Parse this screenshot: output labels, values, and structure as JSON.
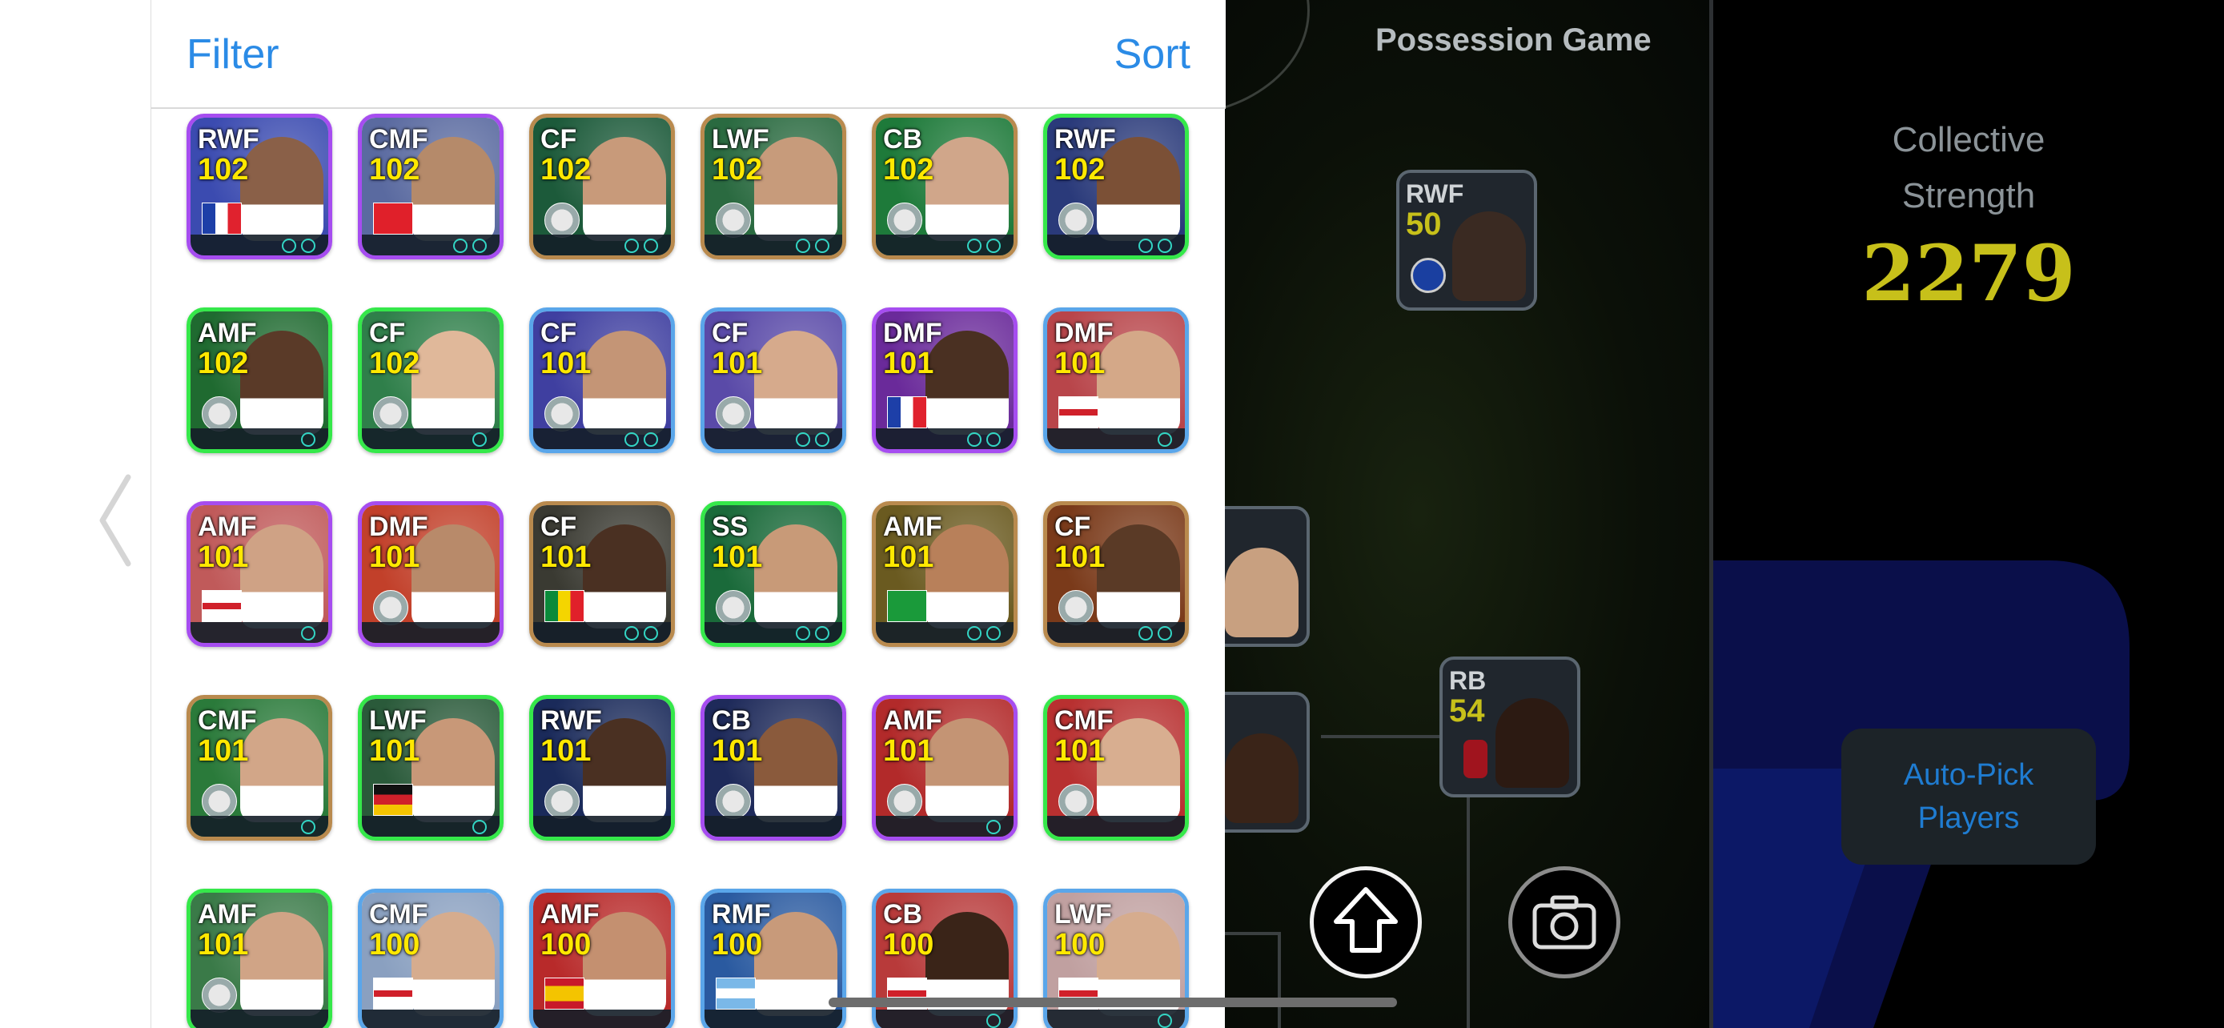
{
  "panel": {
    "filter_label": "Filter",
    "sort_label": "Sort"
  },
  "players": [
    {
      "pos": "RWF",
      "rating": "102",
      "flag": "france",
      "border": "purple",
      "chips": 2,
      "bg": "#3b4bb0",
      "photo": "#8a6048"
    },
    {
      "pos": "CMF",
      "rating": "102",
      "flag": "turkey",
      "border": "purple",
      "chips": 2,
      "bg": "#5a6aa0",
      "photo": "#b58a6a"
    },
    {
      "pos": "CF",
      "rating": "102",
      "flag": "club-crest",
      "border": "gold",
      "chips": 2,
      "bg": "#1c5a3a",
      "photo": "#c89a7a"
    },
    {
      "pos": "LWF",
      "rating": "102",
      "flag": "club-crest",
      "border": "gold",
      "chips": 2,
      "bg": "#2a6a40",
      "photo": "#c79b7b"
    },
    {
      "pos": "CB",
      "rating": "102",
      "flag": "club-crest",
      "border": "gold",
      "chips": 2,
      "bg": "#1e7a3a",
      "photo": "#d0a68a"
    },
    {
      "pos": "RWF",
      "rating": "102",
      "flag": "club-crest",
      "border": "green",
      "chips": 2,
      "bg": "#2a3a7a",
      "photo": "#7b5036"
    },
    {
      "pos": "AMF",
      "rating": "102",
      "flag": "club-crest",
      "border": "green",
      "chips": 1,
      "bg": "#1f6a30",
      "photo": "#5a3a28"
    },
    {
      "pos": "CF",
      "rating": "102",
      "flag": "club-crest",
      "border": "green",
      "chips": 1,
      "bg": "#2f7f4a",
      "photo": "#e0b89a"
    },
    {
      "pos": "CF",
      "rating": "101",
      "flag": "club-crest",
      "border": "blue",
      "chips": 2,
      "bg": "#3f3fa0",
      "photo": "#c49576"
    },
    {
      "pos": "CF",
      "rating": "101",
      "flag": "club-crest",
      "border": "blue",
      "chips": 2,
      "bg": "#5a4aa8",
      "photo": "#d6aa8c"
    },
    {
      "pos": "DMF",
      "rating": "101",
      "flag": "france",
      "border": "purple",
      "chips": 2,
      "bg": "#6a2a9a",
      "photo": "#4a3022"
    },
    {
      "pos": "DMF",
      "rating": "101",
      "flag": "england",
      "border": "blue",
      "chips": 1,
      "bg": "#b8454a",
      "photo": "#d4a888"
    },
    {
      "pos": "AMF",
      "rating": "101",
      "flag": "england",
      "border": "purple",
      "chips": 1,
      "bg": "#c05a5a",
      "photo": "#cfa285"
    },
    {
      "pos": "DMF",
      "rating": "101",
      "flag": "club-crest",
      "border": "purple",
      "chips": 0,
      "bg": "#c2402a",
      "photo": "#b88a6a"
    },
    {
      "pos": "CF",
      "rating": "101",
      "flag": "senegal",
      "border": "gold",
      "chips": 2,
      "bg": "#3a3a32",
      "photo": "#4a3022"
    },
    {
      "pos": "SS",
      "rating": "101",
      "flag": "club-crest",
      "border": "green",
      "chips": 2,
      "bg": "#1a6a3a",
      "photo": "#c89a78"
    },
    {
      "pos": "AMF",
      "rating": "101",
      "flag": "brazil",
      "border": "gold",
      "chips": 2,
      "bg": "#6a5a20",
      "photo": "#b8805a"
    },
    {
      "pos": "CF",
      "rating": "101",
      "flag": "club-crest",
      "border": "gold",
      "chips": 2,
      "bg": "#7a3a1a",
      "photo": "#5a3a26"
    },
    {
      "pos": "CMF",
      "rating": "101",
      "flag": "club-crest",
      "border": "gold",
      "chips": 1,
      "bg": "#2a7a3a",
      "photo": "#d2a688"
    },
    {
      "pos": "LWF",
      "rating": "101",
      "flag": "germany",
      "border": "green",
      "chips": 1,
      "bg": "#2a5a3a",
      "photo": "#c89878"
    },
    {
      "pos": "RWF",
      "rating": "101",
      "flag": "club-crest",
      "border": "green",
      "chips": 0,
      "bg": "#1a2a5a",
      "photo": "#4a3022"
    },
    {
      "pos": "CB",
      "rating": "101",
      "flag": "club-crest",
      "border": "purple",
      "chips": 0,
      "bg": "#1e2a5a",
      "photo": "#8a5a3c"
    },
    {
      "pos": "AMF",
      "rating": "101",
      "flag": "club-crest",
      "border": "purple",
      "chips": 1,
      "bg": "#b22a2a",
      "photo": "#c49474"
    },
    {
      "pos": "CMF",
      "rating": "101",
      "flag": "club-crest",
      "border": "green",
      "chips": 0,
      "bg": "#b83030",
      "photo": "#d8ae90"
    },
    {
      "pos": "AMF",
      "rating": "101",
      "flag": "club-crest",
      "border": "green",
      "chips": 0,
      "bg": "#3a7a48",
      "photo": "#d0a486"
    },
    {
      "pos": "CMF",
      "rating": "100",
      "flag": "england",
      "border": "blue",
      "chips": 0,
      "bg": "#8aa0c0",
      "photo": "#d6ac8e"
    },
    {
      "pos": "AMF",
      "rating": "100",
      "flag": "spain",
      "border": "blue",
      "chips": 0,
      "bg": "#b82a2a",
      "photo": "#c49070"
    },
    {
      "pos": "RMF",
      "rating": "100",
      "flag": "argentina",
      "border": "blue",
      "chips": 0,
      "bg": "#2a5aa0",
      "photo": "#c89a7a"
    },
    {
      "pos": "CB",
      "rating": "100",
      "flag": "england",
      "border": "blue",
      "chips": 1,
      "bg": "#b83a3a",
      "photo": "#3a2418"
    },
    {
      "pos": "LWF",
      "rating": "100",
      "flag": "england",
      "border": "blue",
      "chips": 1,
      "bg": "#c0a0a0",
      "photo": "#d6ac8e"
    }
  ],
  "formation": {
    "title": "Possession Game",
    "slots": [
      {
        "pos": "RWF",
        "rating": "50",
        "badge": "club-crest-blue"
      },
      {
        "pos": "",
        "rating": "",
        "badge": ""
      },
      {
        "pos": "",
        "rating": "",
        "badge": ""
      },
      {
        "pos": "RB",
        "rating": "54",
        "badge": "club-crest-red"
      }
    ]
  },
  "strength": {
    "label_line1": "Collective",
    "label_line2": "Strength",
    "value": "2279"
  },
  "autopick": {
    "line1": "Auto-Pick",
    "line2": "Players"
  },
  "icons": {
    "back": "chevron-left-icon",
    "upload": "arrow-up-icon",
    "camera": "camera-icon"
  },
  "colors": {
    "accent": "#2b8be6",
    "rating_yellow": "#ffe800",
    "strength_yellow": "#c7c01a",
    "border_purple": "#a64df0",
    "border_green": "#35e84a",
    "border_gold": "#b98a4e",
    "border_blue": "#5aa6ea"
  }
}
